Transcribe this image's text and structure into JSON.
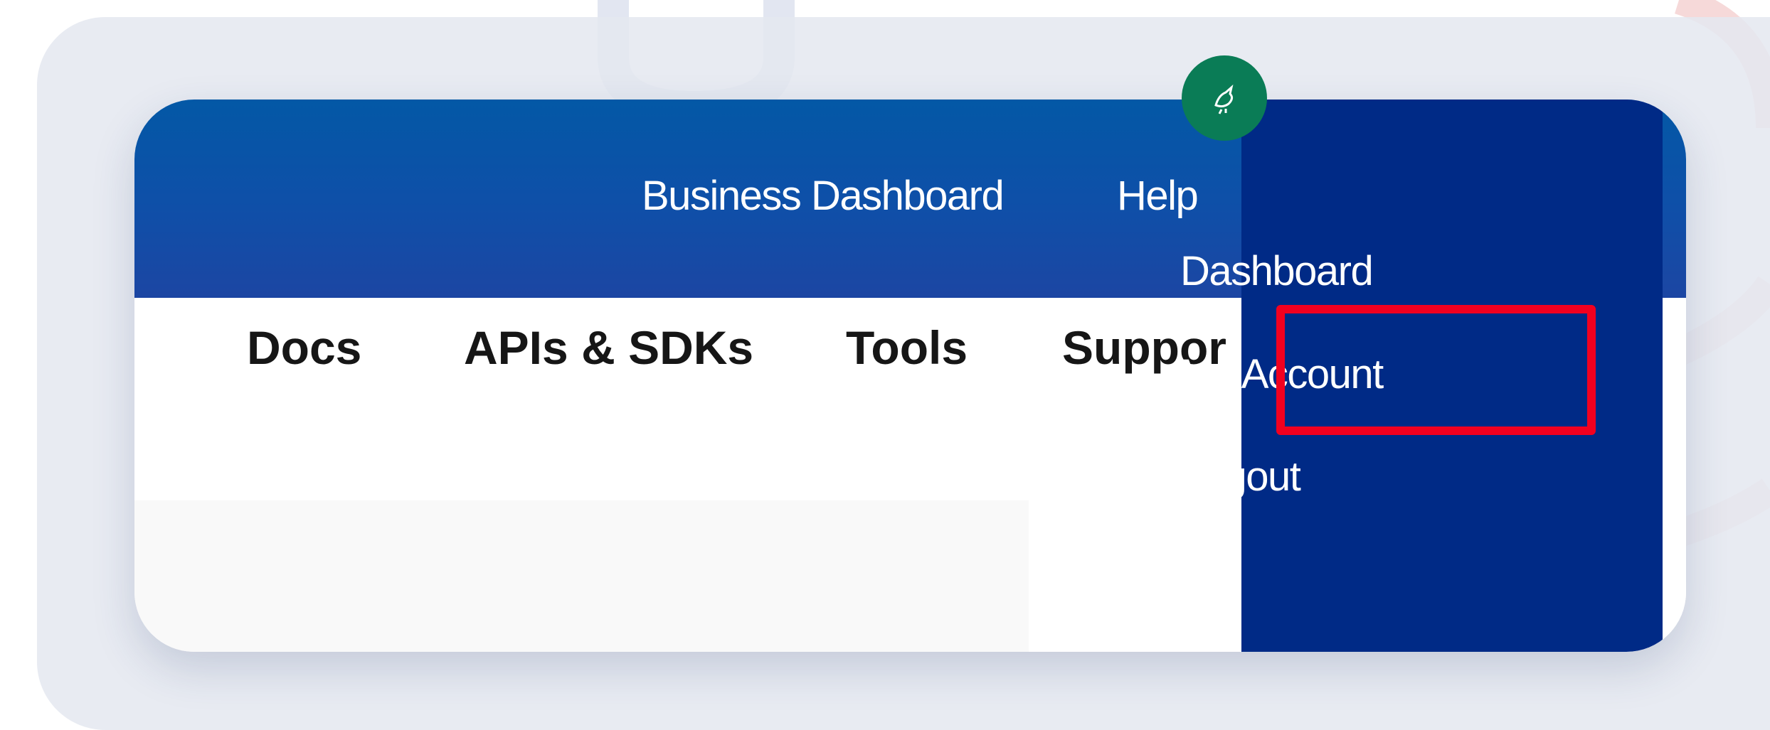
{
  "top_bar": {
    "business_dashboard": "Business Dashboard",
    "help": "Help"
  },
  "nav": {
    "items": [
      {
        "label": "Docs"
      },
      {
        "label": "APIs & SDKs"
      },
      {
        "label": "Tools"
      },
      {
        "label": "Suppor"
      }
    ]
  },
  "user_menu": {
    "avatar_icon": "bird-logo-icon",
    "items": [
      {
        "label": "Dashboard",
        "highlighted": true
      },
      {
        "label": "My Account"
      },
      {
        "label": "Logout"
      }
    ]
  },
  "colors": {
    "top_bar": "#0f4fa8",
    "dropdown": "#002a86",
    "avatar": "#0a7c56",
    "highlight": "#f2001f"
  }
}
